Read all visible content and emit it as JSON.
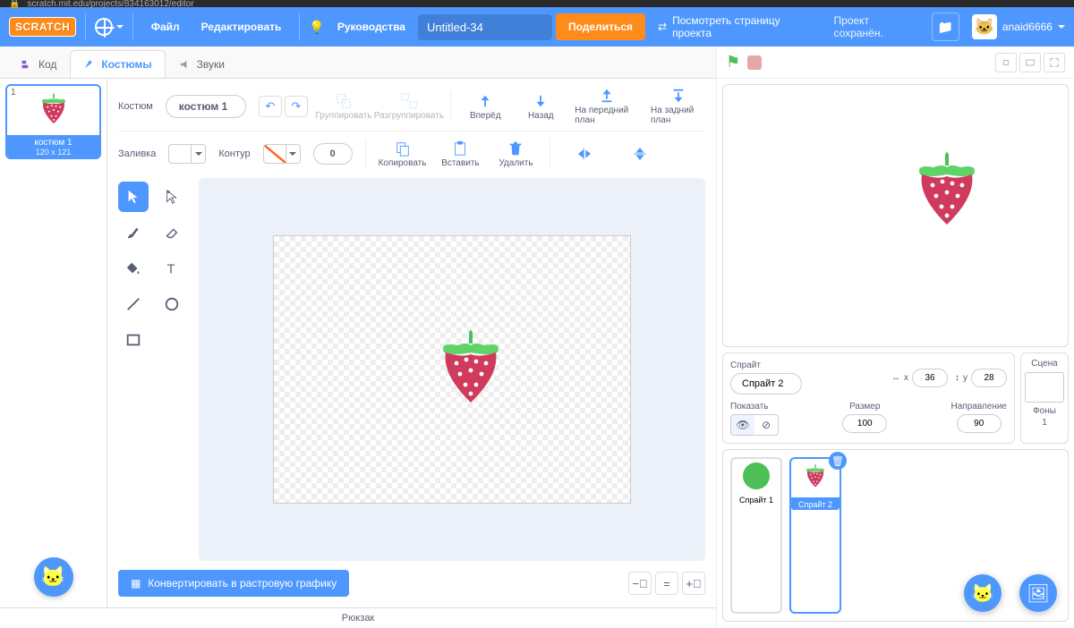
{
  "browser": {
    "url": "scratch.mit.edu/projects/834163012/editor"
  },
  "menu": {
    "logo": "SCRATCH",
    "file": "Файл",
    "edit": "Редактировать",
    "tutorials": "Руководства",
    "title": "Untitled-34",
    "share": "Поделиться",
    "see_project": "Посмотреть страницу проекта",
    "saved": "Проект сохранён.",
    "username": "anaid6666"
  },
  "tabs": {
    "code": "Код",
    "costumes": "Костюмы",
    "sounds": "Звуки"
  },
  "costume_list": {
    "items": [
      {
        "index": "1",
        "name": "костюм 1",
        "dims": "120 x 121"
      }
    ]
  },
  "paint": {
    "costume_lbl": "Костюм",
    "costume_name": "костюм 1",
    "group": "Группировать",
    "ungroup": "Разгруппировать",
    "forward": "Вперёд",
    "backward": "Назад",
    "front": "На передний план",
    "back": "На задний план",
    "fill": "Заливка",
    "outline": "Контур",
    "thickness": "0",
    "copy": "Копировать",
    "paste": "Вставить",
    "delete": "Удалить",
    "convert": "Конвертировать в растровую графику"
  },
  "sprite_panel": {
    "sprite_lbl": "Спрайт",
    "sprite_name": "Спрайт 2",
    "x_lbl": "x",
    "x_val": "36",
    "y_lbl": "y",
    "y_val": "28",
    "show_lbl": "Показать",
    "size_lbl": "Размер",
    "size_val": "100",
    "dir_lbl": "Направление",
    "dir_val": "90"
  },
  "stage_col": {
    "title": "Сцена",
    "backdrops_lbl": "Фоны",
    "backdrops_count": "1"
  },
  "sprites": [
    {
      "name": "Спрайт 1"
    },
    {
      "name": "Спрайт 2"
    }
  ],
  "backpack": "Рюкзак"
}
